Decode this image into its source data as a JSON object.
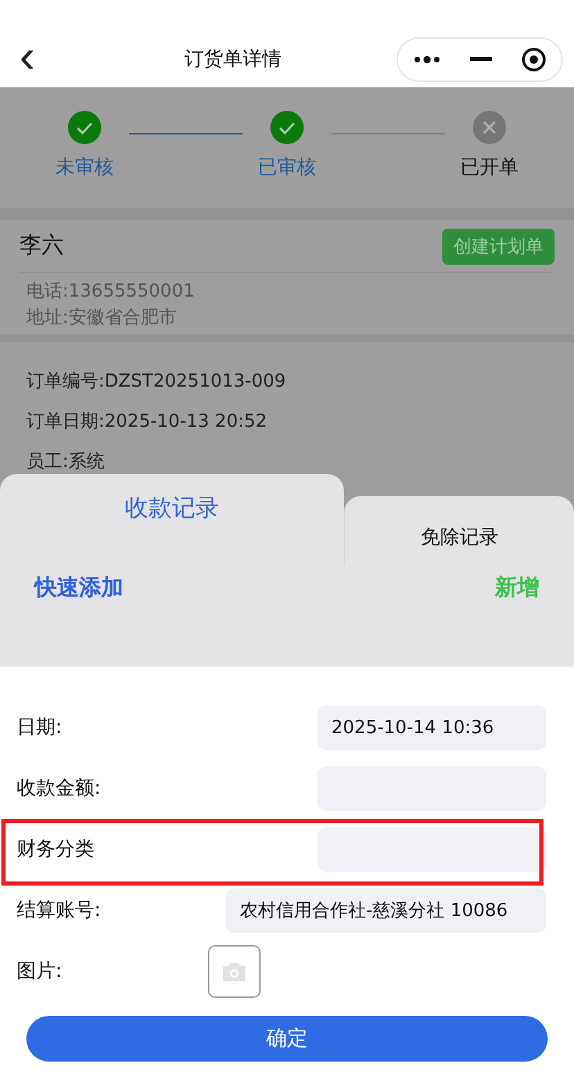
{
  "nav": {
    "title": "订货单详情",
    "back": "‹"
  },
  "steps": [
    {
      "label": "未审核",
      "done": true
    },
    {
      "label": "已审核",
      "done": true
    },
    {
      "label": "已开单",
      "done": false
    }
  ],
  "customer": {
    "name": "李六",
    "action": "创建计划单",
    "phone": "电话:13655550001",
    "address": "地址:安徽省合肥市"
  },
  "order": [
    "订单编号:DZST20251013-009",
    "订单日期:2025-10-13 20:52",
    "员工:系统"
  ],
  "tabs": [
    {
      "label": "收款记录",
      "selected": true
    },
    {
      "label": "免除记录",
      "selected": false
    }
  ],
  "quick_add": "快速添加",
  "add": "新增",
  "form": [
    {
      "kind": "text",
      "label": "日期:",
      "value": "2025-10-14 10:36",
      "highlighted": false
    },
    {
      "kind": "text",
      "label": "收款金额:",
      "highlighted": false
    },
    {
      "kind": "text",
      "label": "财务分类",
      "highlighted": true
    },
    {
      "kind": "wide",
      "label": "结算账号:",
      "value": "农村信用合作社-慈溪分社 10086",
      "highlighted": false
    },
    {
      "kind": "image",
      "label": "图片:",
      "highlighted": false
    }
  ],
  "confirm": "确定"
}
